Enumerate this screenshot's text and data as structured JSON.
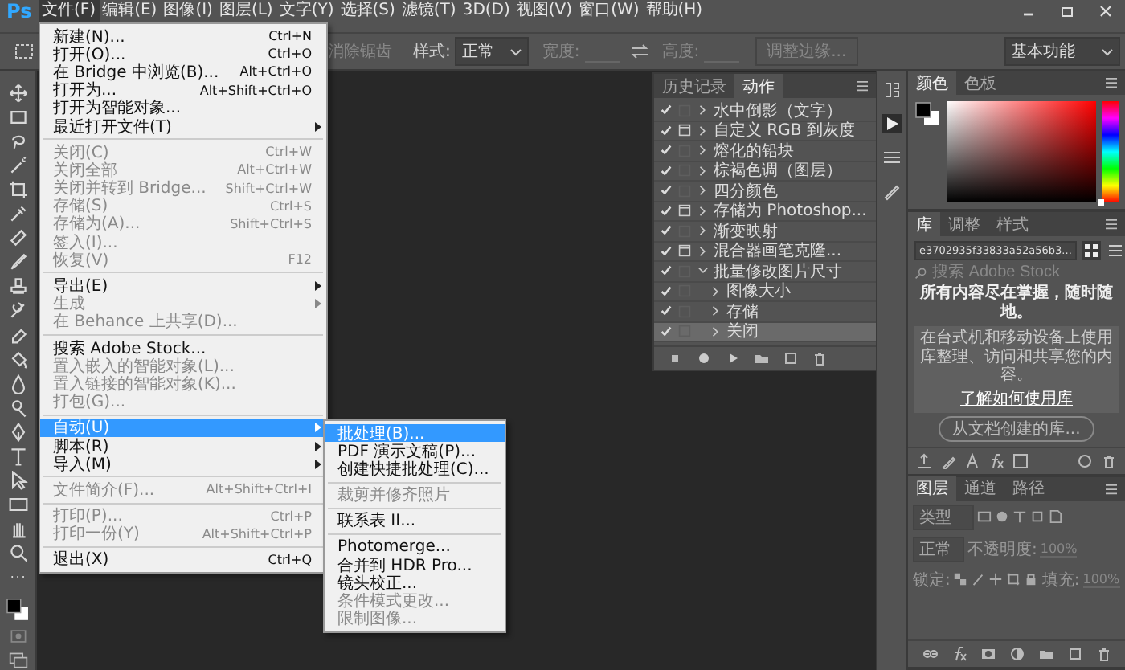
{
  "menubar": {
    "logo": "Ps",
    "items": [
      {
        "label": "文件(F)",
        "selected": true
      },
      {
        "label": "编辑(E)",
        "selected": false
      },
      {
        "label": "图像(I)",
        "selected": false
      },
      {
        "label": "图层(L)",
        "selected": false
      },
      {
        "label": "文字(Y)",
        "selected": false
      },
      {
        "label": "选择(S)",
        "selected": false
      },
      {
        "label": "滤镜(T)",
        "selected": false
      },
      {
        "label": "3D(D)",
        "selected": false
      },
      {
        "label": "视图(V)",
        "selected": false
      },
      {
        "label": "窗口(W)",
        "selected": false
      },
      {
        "label": "帮助(H)",
        "selected": false
      }
    ]
  },
  "options_bar": {
    "antialias": "消除锯齿",
    "style_label": "样式:",
    "style_value": "正常",
    "width_label": "宽度:",
    "height_label": "高度:",
    "refine_button": "调整边缘...",
    "workspace": "基本功能"
  },
  "file_menu": {
    "items": [
      {
        "kind": "item",
        "label": "新建(N)...",
        "shortcut": "Ctrl+N",
        "submenu": false,
        "disabled": false,
        "selected": false
      },
      {
        "kind": "item",
        "label": "打开(O)...",
        "shortcut": "Ctrl+O",
        "submenu": false,
        "disabled": false,
        "selected": false
      },
      {
        "kind": "item",
        "label": "在 Bridge 中浏览(B)...",
        "shortcut": "Alt+Ctrl+O",
        "submenu": false,
        "disabled": false,
        "selected": false
      },
      {
        "kind": "item",
        "label": "打开为...",
        "shortcut": "Alt+Shift+Ctrl+O",
        "submenu": false,
        "disabled": false,
        "selected": false
      },
      {
        "kind": "item",
        "label": "打开为智能对象...",
        "submenu": false,
        "disabled": false,
        "selected": false
      },
      {
        "kind": "item",
        "label": "最近打开文件(T)",
        "submenu": true,
        "disabled": false,
        "selected": false
      },
      {
        "kind": "separator"
      },
      {
        "kind": "item",
        "label": "关闭(C)",
        "shortcut": "Ctrl+W",
        "submenu": false,
        "disabled": true,
        "selected": false
      },
      {
        "kind": "item",
        "label": "关闭全部",
        "shortcut": "Alt+Ctrl+W",
        "submenu": false,
        "disabled": true,
        "selected": false
      },
      {
        "kind": "item",
        "label": "关闭并转到 Bridge...",
        "shortcut": "Shift+Ctrl+W",
        "submenu": false,
        "disabled": true,
        "selected": false
      },
      {
        "kind": "item",
        "label": "存储(S)",
        "shortcut": "Ctrl+S",
        "submenu": false,
        "disabled": true,
        "selected": false
      },
      {
        "kind": "item",
        "label": "存储为(A)...",
        "shortcut": "Shift+Ctrl+S",
        "submenu": false,
        "disabled": true,
        "selected": false
      },
      {
        "kind": "item",
        "label": "签入(I)...",
        "submenu": false,
        "disabled": true,
        "selected": false
      },
      {
        "kind": "item",
        "label": "恢复(V)",
        "shortcut": "F12",
        "submenu": false,
        "disabled": true,
        "selected": false
      },
      {
        "kind": "separator"
      },
      {
        "kind": "item",
        "label": "导出(E)",
        "submenu": true,
        "disabled": false,
        "selected": false
      },
      {
        "kind": "item",
        "label": "生成",
        "submenu": true,
        "disabled": true,
        "selected": false
      },
      {
        "kind": "item",
        "label": "在 Behance 上共享(D)...",
        "submenu": false,
        "disabled": true,
        "selected": false
      },
      {
        "kind": "separator"
      },
      {
        "kind": "item",
        "label": "搜索 Adobe Stock...",
        "submenu": false,
        "disabled": false,
        "selected": false
      },
      {
        "kind": "item",
        "label": "置入嵌入的智能对象(L)...",
        "submenu": false,
        "disabled": true,
        "selected": false
      },
      {
        "kind": "item",
        "label": "置入链接的智能对象(K)...",
        "submenu": false,
        "disabled": true,
        "selected": false
      },
      {
        "kind": "item",
        "label": "打包(G)...",
        "submenu": false,
        "disabled": true,
        "selected": false
      },
      {
        "kind": "separator"
      },
      {
        "kind": "item",
        "label": "自动(U)",
        "submenu": true,
        "disabled": false,
        "selected": true
      },
      {
        "kind": "item",
        "label": "脚本(R)",
        "submenu": true,
        "disabled": false,
        "selected": false
      },
      {
        "kind": "item",
        "label": "导入(M)",
        "submenu": true,
        "disabled": false,
        "selected": false
      },
      {
        "kind": "separator"
      },
      {
        "kind": "item",
        "label": "文件简介(F)...",
        "shortcut": "Alt+Shift+Ctrl+I",
        "submenu": false,
        "disabled": true,
        "selected": false
      },
      {
        "kind": "separator"
      },
      {
        "kind": "item",
        "label": "打印(P)...",
        "shortcut": "Ctrl+P",
        "submenu": false,
        "disabled": true,
        "selected": false
      },
      {
        "kind": "item",
        "label": "打印一份(Y)",
        "shortcut": "Alt+Shift+Ctrl+P",
        "submenu": false,
        "disabled": true,
        "selected": false
      },
      {
        "kind": "separator"
      },
      {
        "kind": "item",
        "label": "退出(X)",
        "shortcut": "Ctrl+Q",
        "submenu": false,
        "disabled": false,
        "selected": false
      }
    ]
  },
  "automate_submenu": {
    "items": [
      {
        "kind": "item",
        "label": "批处理(B)...",
        "submenu": false,
        "disabled": false,
        "selected": true
      },
      {
        "kind": "item",
        "label": "PDF 演示文稿(P)...",
        "submenu": false,
        "disabled": false,
        "selected": false
      },
      {
        "kind": "item",
        "label": "创建快捷批处理(C)...",
        "submenu": false,
        "disabled": false,
        "selected": false
      },
      {
        "kind": "separator"
      },
      {
        "kind": "item",
        "label": "裁剪并修齐照片",
        "submenu": false,
        "disabled": true,
        "selected": false
      },
      {
        "kind": "separator"
      },
      {
        "kind": "item",
        "label": "联系表 II...",
        "submenu": false,
        "disabled": false,
        "selected": false
      },
      {
        "kind": "separator"
      },
      {
        "kind": "item",
        "label": "Photomerge...",
        "submenu": false,
        "disabled": false,
        "selected": false
      },
      {
        "kind": "item",
        "label": "合并到 HDR Pro...",
        "submenu": false,
        "disabled": false,
        "selected": false
      },
      {
        "kind": "item",
        "label": "镜头校正...",
        "submenu": false,
        "disabled": false,
        "selected": false
      },
      {
        "kind": "item",
        "label": "条件模式更改...",
        "submenu": false,
        "disabled": true,
        "selected": false
      },
      {
        "kind": "item",
        "label": "限制图像...",
        "submenu": false,
        "disabled": true,
        "selected": false
      }
    ]
  },
  "actions_panel": {
    "tabs": [
      {
        "label": "历史记录",
        "selected": false
      },
      {
        "label": "动作",
        "selected": true
      }
    ],
    "rows": [
      {
        "label": "水中倒影（文字）",
        "checked": true,
        "dialog": false,
        "expanded": false,
        "selected": false
      },
      {
        "label": "自定义 RGB 到灰度",
        "checked": true,
        "dialog": true,
        "expanded": false,
        "selected": false
      },
      {
        "label": "熔化的铅块",
        "checked": true,
        "dialog": false,
        "expanded": false,
        "selected": false
      },
      {
        "label": "棕褐色调（图层）",
        "checked": true,
        "dialog": false,
        "expanded": false,
        "selected": false
      },
      {
        "label": "四分颜色",
        "checked": true,
        "dialog": false,
        "expanded": false,
        "selected": false
      },
      {
        "label": "存储为 Photoshop...",
        "checked": true,
        "dialog": true,
        "expanded": false,
        "selected": false
      },
      {
        "label": "渐变映射",
        "checked": true,
        "dialog": false,
        "expanded": false,
        "selected": false
      },
      {
        "label": "混合器画笔克隆...",
        "checked": true,
        "dialog": true,
        "expanded": false,
        "selected": false
      },
      {
        "label": "批量修改图片尺寸",
        "checked": true,
        "dialog": false,
        "expanded": true,
        "selected": false,
        "children": [
          {
            "label": "图像大小",
            "checked": true,
            "dialog": false,
            "expanded": false,
            "selected": false
          },
          {
            "label": "存储",
            "checked": true,
            "dialog": false,
            "expanded": false,
            "selected": false
          },
          {
            "label": "关闭",
            "checked": true,
            "dialog": false,
            "expanded": false,
            "selected": true
          }
        ]
      }
    ]
  },
  "color_panel": {
    "tabs": [
      {
        "label": "颜色",
        "selected": true
      },
      {
        "label": "色板",
        "selected": false
      }
    ],
    "hue": {
      "level": 0
    }
  },
  "library_panel": {
    "tabs": [
      {
        "label": "库",
        "selected": true
      },
      {
        "label": "调整",
        "selected": false
      },
      {
        "label": "样式",
        "selected": false
      }
    ],
    "library_name": "e3702935f33833a52a56b3...",
    "search_placeholder": "搜索 Adobe Stock",
    "headline": "所有内容尽在掌握，随时随地。",
    "body": "在台式机和移动设备上使用库整理、访问和共享您的内容。",
    "link": "了解如何使用库",
    "create_button": "从文档创建的库..."
  },
  "layers_panel": {
    "tabs": [
      {
        "label": "图层",
        "selected": true
      },
      {
        "label": "通道",
        "selected": false
      },
      {
        "label": "路径",
        "selected": false
      }
    ],
    "filter": "类型",
    "blend_mode": "正常",
    "opacity_label": "不透明度:",
    "opacity": "100%",
    "lock_label": "锁定:",
    "fill_label": "填充:",
    "fill": "100%"
  }
}
